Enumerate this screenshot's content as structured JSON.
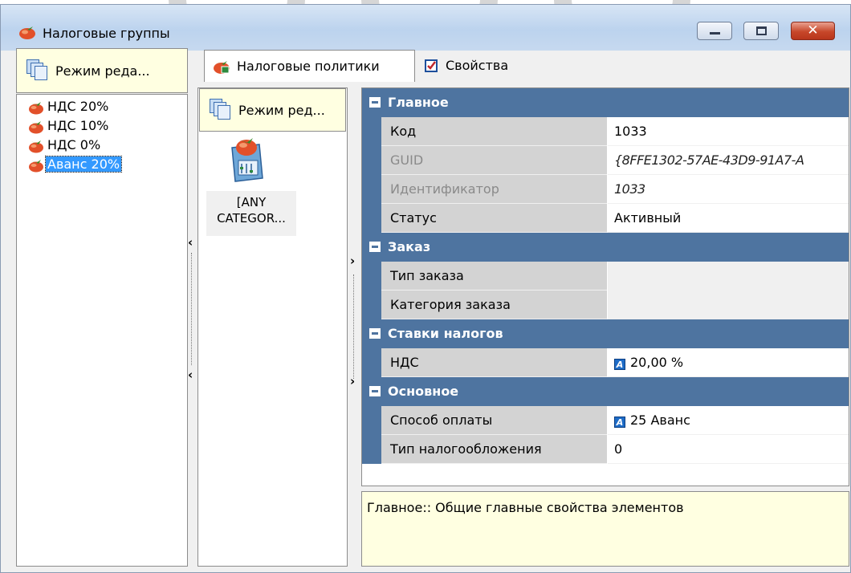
{
  "window": {
    "title": "Налоговые группы",
    "controls": {
      "minimize": "minimize",
      "maximize": "maximize",
      "close": "✕"
    }
  },
  "left_pane": {
    "mode_button": "Режим реда...",
    "tree_items": [
      {
        "label": "НДС 20%",
        "selected": false
      },
      {
        "label": "НДС 10%",
        "selected": false
      },
      {
        "label": "НДС 0%",
        "selected": false
      },
      {
        "label": "Аванс 20%",
        "selected": true
      }
    ]
  },
  "tabs": [
    {
      "label": "Налоговые политики",
      "active": true,
      "icon": "tax-policy-icon"
    },
    {
      "label": "Свойства",
      "active": false,
      "icon": "properties-checkbox-icon"
    }
  ],
  "middle_pane": {
    "mode_button": "Режим ред...",
    "category_label_line1": "[ANY",
    "category_label_line2": "CATEGOR..."
  },
  "property_grid": {
    "categories": [
      {
        "label": "Главное",
        "props": [
          {
            "name": "Код",
            "value": "1033",
            "dim": false,
            "italic": false
          },
          {
            "name": "GUID",
            "value": "{8FFE1302-57AE-43D9-91A7-A",
            "dim": true,
            "italic": true
          },
          {
            "name": "Идентификатор",
            "value": "1033",
            "dim": true,
            "italic": true
          },
          {
            "name": "Статус",
            "value": "Активный",
            "dim": false,
            "italic": false
          }
        ]
      },
      {
        "label": "Заказ",
        "props": [
          {
            "name": "Тип заказа",
            "value": "",
            "dim": false,
            "italic": false
          },
          {
            "name": "Категория заказа",
            "value": "",
            "dim": false,
            "italic": false
          }
        ]
      },
      {
        "label": "Ставки налогов",
        "props": [
          {
            "name": "НДС",
            "value": "20,00 %",
            "dim": false,
            "italic": false,
            "badge": "A"
          }
        ]
      },
      {
        "label": "Основное",
        "props": [
          {
            "name": "Способ оплаты",
            "value": "25 Аванс",
            "dim": false,
            "italic": false,
            "badge": "A"
          },
          {
            "name": "Тип налогообложения",
            "value": "0",
            "dim": false,
            "italic": false
          }
        ]
      }
    ]
  },
  "description": "Главное:: Общие главные свойства элементов",
  "colors": {
    "category_header": "#4e74a0",
    "selection": "#3399ff",
    "tooltip_bg": "#ffffe1"
  }
}
